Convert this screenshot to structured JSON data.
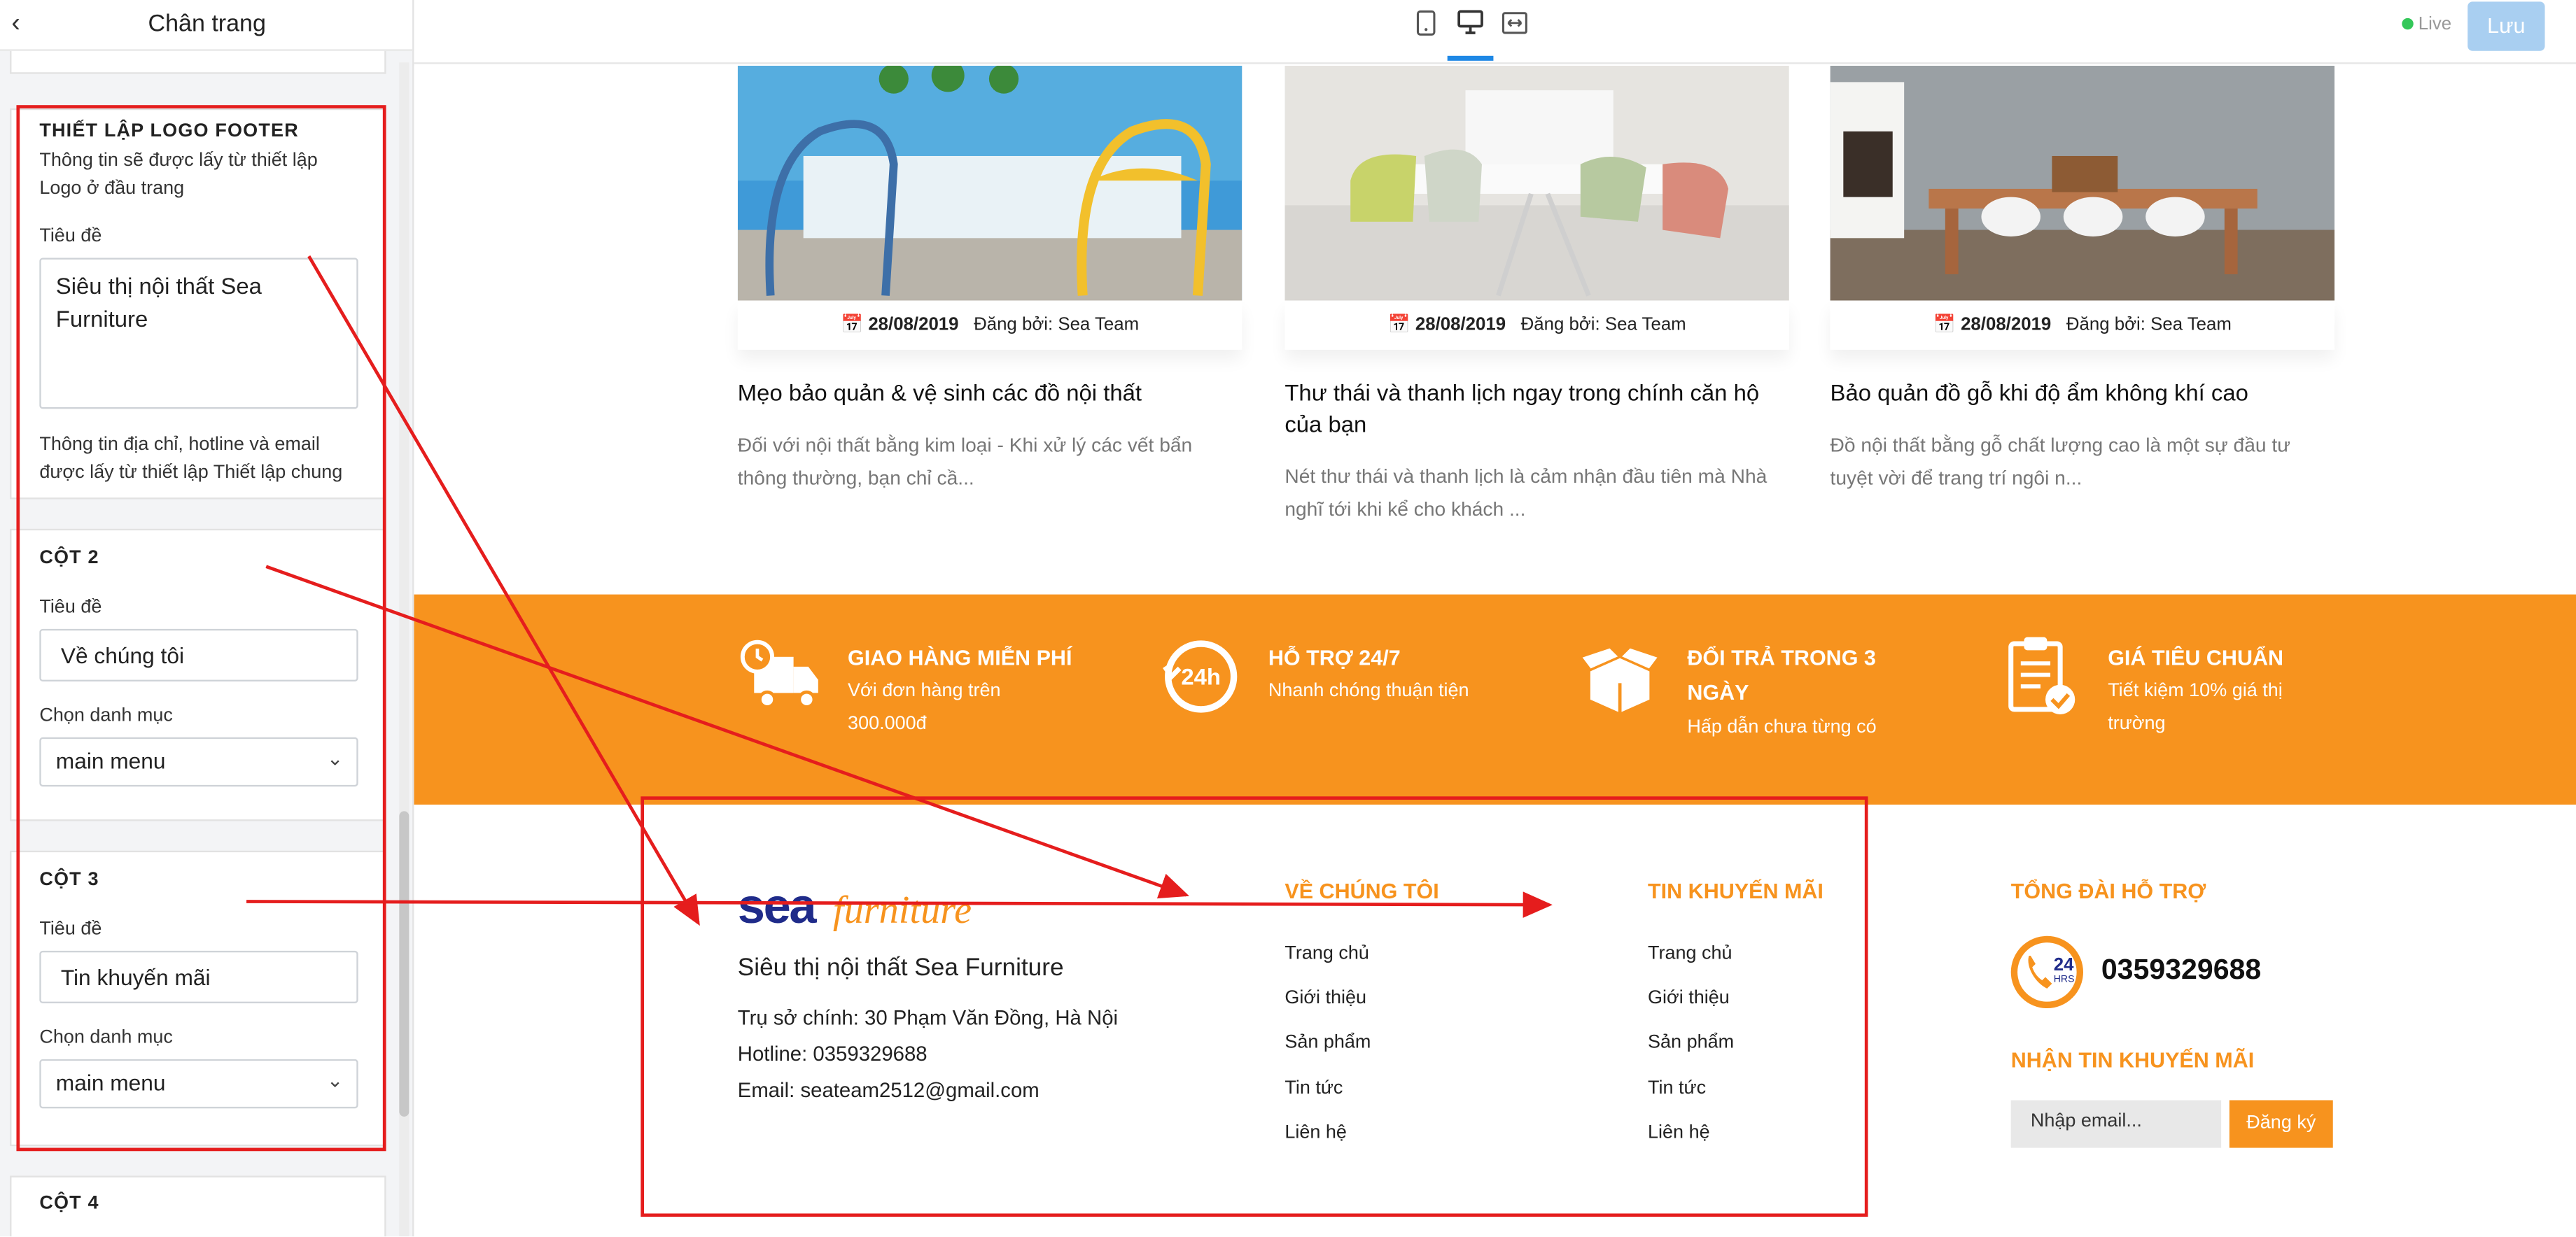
{
  "sidebar": {
    "back_icon": "chevron-left-icon",
    "title": "Chân trang",
    "logo_section": {
      "heading": "THIẾT LẬP LOGO FOOTER",
      "desc": "Thông tin sẽ được lấy từ thiết lập Logo ở đầu trang",
      "title_label": "Tiêu đề",
      "title_value": "Siêu thị nội thất Sea Furniture",
      "note": "Thông tin địa chỉ, hotline và email được lấy từ thiết lập Thiết lập chung"
    },
    "col2": {
      "heading": "CỘT 2",
      "title_label": "Tiêu đề",
      "title_value": "Về chúng tôi",
      "category_label": "Chọn danh mục",
      "category_value": "main menu"
    },
    "col3": {
      "heading": "CỘT 3",
      "title_label": "Tiêu đề",
      "title_value": "Tin khuyến mãi",
      "category_label": "Chọn danh mục",
      "category_value": "main menu"
    },
    "col4": {
      "heading": "CỘT 4"
    }
  },
  "topbar": {
    "devices": [
      "mobile-icon",
      "desktop-icon",
      "fullwidth-icon"
    ],
    "live_label": "Live",
    "save_label": "Lưu"
  },
  "posts": [
    {
      "date": "28/08/2019",
      "by_label": "Đăng bởi:",
      "author": "Sea Team",
      "title": "Mẹo bảo quản & vệ sinh các đồ nội thất",
      "excerpt": "Đối với nội thất bằng kim loại - Khi xử lý các vết bẩn thông thường, bạn chỉ cầ..."
    },
    {
      "date": "28/08/2019",
      "by_label": "Đăng bởi:",
      "author": "Sea Team",
      "title": "Thư thái và thanh lịch ngay trong chính căn hộ của bạn",
      "excerpt": "Nét thư thái và thanh lịch là cảm nhận đầu tiên mà Nhà nghĩ tới khi kể cho khách ..."
    },
    {
      "date": "28/08/2019",
      "by_label": "Đăng bởi:",
      "author": "Sea Team",
      "title": "Bảo quản đồ gỗ khi độ ẩm không khí cao",
      "excerpt": "Đồ nội thất bằng gỗ chất lượng cao là một sự đầu tư tuyệt vời để trang trí ngôi n..."
    }
  ],
  "features": [
    {
      "icon": "delivery-truck-icon",
      "title": "GIAO HÀNG MIỄN PHÍ",
      "desc": "Với đơn hàng trên 300.000đ"
    },
    {
      "icon": "support-24h-icon",
      "title": "HỖ TRỢ 24/7",
      "desc": "Nhanh chóng thuận tiện"
    },
    {
      "icon": "open-box-icon",
      "title": "ĐỔI TRẢ TRONG 3 NGÀY",
      "desc": "Hấp dẫn chưa từng có"
    },
    {
      "icon": "clipboard-check-icon",
      "title": "GIÁ TIÊU CHUẨN",
      "desc": "Tiết kiệm 10% giá thị trường"
    }
  ],
  "footer": {
    "logo_word": "sea",
    "logo_script": "furniture",
    "tagline": "Siêu thị nội thất Sea Furniture",
    "address": "Trụ sở chính: 30 Phạm Văn Đồng, Hà Nội",
    "hotline": "Hotline: 0359329688",
    "email": "Email: seateam2512@gmail.com",
    "col2": {
      "heading": "VỀ CHÚNG TÔI",
      "items": [
        "Trang chủ",
        "Giới thiệu",
        "Sản phẩm",
        "Tin tức",
        "Liên hệ"
      ]
    },
    "col3": {
      "heading": "TIN KHUYẾN MÃI",
      "items": [
        "Trang chủ",
        "Giới thiệu",
        "Sản phẩm",
        "Tin tức",
        "Liên hệ"
      ]
    },
    "support_heading": "TỔNG ĐÀI HỖ TRỢ",
    "support_icon_text": "24",
    "support_icon_sub": "HRS",
    "support_phone": "0359329688",
    "newsletter_heading": "NHẬN TIN KHUYẾN MÃI",
    "email_placeholder": "Nhập email...",
    "subscribe_label": "Đăng ký"
  },
  "colors": {
    "accent": "#f7931e",
    "annotation": "#e51d1d",
    "primary": "#1e88e5"
  }
}
